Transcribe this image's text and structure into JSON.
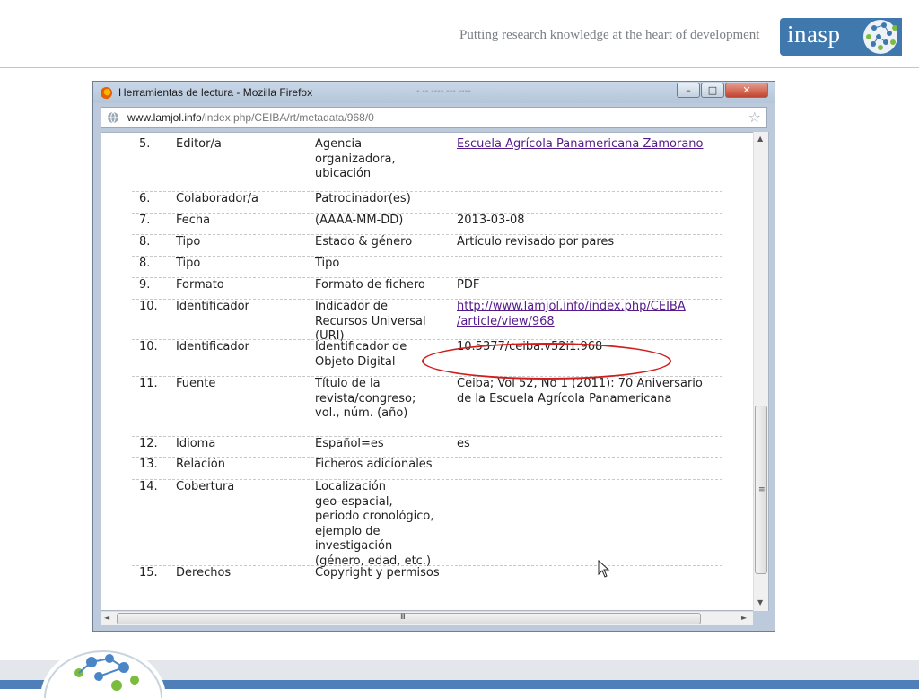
{
  "slide": {
    "tagline": "Putting research knowledge at the heart of development",
    "logo_text": "inasp"
  },
  "browser": {
    "title": "Herramientas de lectura - Mozilla Firefox",
    "url_domain": "www.lamjol.info",
    "url_path": "/index.php/CEIBA/rt/metadata/968/0"
  },
  "rows": [
    {
      "num": "5.",
      "element": "Editor/a",
      "qualifier": "Agencia\norganizadora,\nubicación",
      "value": "Escuela Agrícola Panamericana Zamorano",
      "link": true
    },
    {
      "num": "6.",
      "element": "Colaborador/a",
      "qualifier": "Patrocinador(es)",
      "value": "",
      "link": false
    },
    {
      "num": "7.",
      "element": "Fecha",
      "qualifier": "(AAAA-MM-DD)",
      "value": "2013-03-08",
      "link": false
    },
    {
      "num": "8.",
      "element": "Tipo",
      "qualifier": "Estado & género",
      "value": "Artículo revisado por pares",
      "link": false
    },
    {
      "num": "8.",
      "element": "Tipo",
      "qualifier": "Tipo",
      "value": "",
      "link": false
    },
    {
      "num": "9.",
      "element": "Formato",
      "qualifier": "Formato de fichero",
      "value": "PDF",
      "link": false
    },
    {
      "num": "10.",
      "element": "Identificador",
      "qualifier": "Indicador de\nRecursos Universal\n(URI)",
      "value": "http://www.lamjol.info/index.php/CEIBA\n/article/view/968",
      "link": true
    },
    {
      "num": "10.",
      "element": "Identificador",
      "qualifier": "Identificador de\nObjeto Digital",
      "value": "10.5377/ceiba.v52i1.968",
      "link": false
    },
    {
      "num": "11.",
      "element": "Fuente",
      "qualifier": "Título de la\nrevista/congreso;\nvol., núm. (año)",
      "value": "Ceiba; Vol 52, No 1 (2011): 70 Aniversario\nde la Escuela Agrícola Panamericana",
      "link": false
    },
    {
      "num": "12.",
      "element": "Idioma",
      "qualifier": "Español=es",
      "value": "es",
      "link": false
    },
    {
      "num": "13.",
      "element": "Relación",
      "qualifier": "Ficheros adicionales",
      "value": "",
      "link": false
    },
    {
      "num": "14.",
      "element": "Cobertura",
      "qualifier": "Localización\ngeo-espacial,\nperiodo cronológico,\nejemplo de\ninvestigación\n(género, edad, etc.)",
      "value": "",
      "link": false
    },
    {
      "num": "15.",
      "element": "Derechos",
      "qualifier": "Copyright y permisos",
      "value": "",
      "link": false
    }
  ]
}
